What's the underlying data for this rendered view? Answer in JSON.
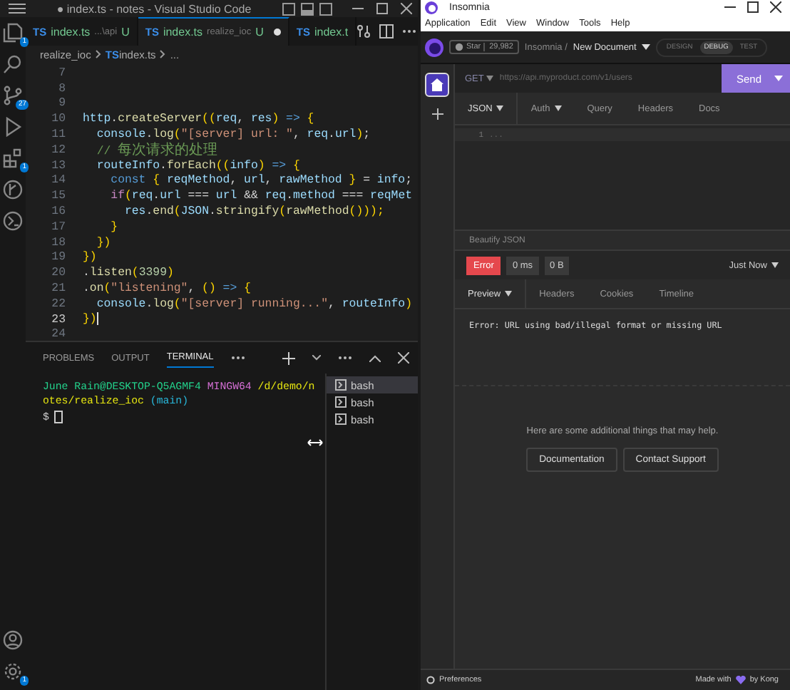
{
  "vscode": {
    "title": "● index.ts - notes - Visual Studio Code",
    "activity_bar": [
      {
        "kind": "files",
        "badge": "1"
      },
      {
        "kind": "search"
      },
      {
        "kind": "branch",
        "badge": "27"
      },
      {
        "kind": "run"
      },
      {
        "kind": "extensions",
        "badge": "1"
      },
      {
        "kind": "graph"
      },
      {
        "kind": "remote"
      }
    ],
    "settings_badge": "1",
    "tabs": [
      {
        "icon": "TS",
        "name": "index.ts",
        "detail": "...\\api",
        "status": "U",
        "selected": false,
        "dirty": false
      },
      {
        "icon": "TS",
        "name": "index.ts",
        "detail": "realize_ioc",
        "status": "U",
        "selected": true,
        "dirty": true
      },
      {
        "icon": "TS",
        "name": "index.t",
        "selected": false,
        "dirty": false
      }
    ],
    "breadcrumb": [
      {
        "text": "realize_ioc"
      },
      {
        "icon": "TS",
        "text": "index.ts"
      },
      {
        "text": "..."
      }
    ],
    "code_lines": [
      {
        "number": "7",
        "current": false
      },
      {
        "number": "8",
        "current": false
      },
      {
        "number": "9",
        "current": false
      },
      {
        "number": "10",
        "current": false,
        "tokens": [
          {
            "text": "http",
            "kind": "var"
          },
          {
            "text": ".",
            "kind": "punc"
          },
          {
            "text": "createServer",
            "kind": "fn"
          },
          {
            "text": "((",
            "kind": "bracket"
          },
          {
            "text": "req",
            "kind": "var"
          },
          {
            "text": ", ",
            "kind": "punc"
          },
          {
            "text": "res",
            "kind": "var"
          },
          {
            "text": ")",
            "kind": "bracket"
          },
          {
            "text": " => ",
            "kind": "kw"
          },
          {
            "text": "{",
            "kind": "bracket"
          }
        ]
      },
      {
        "number": "11",
        "current": false,
        "tokens": [
          {
            "text": "  console",
            "kind": "var"
          },
          {
            "text": ".",
            "kind": "punc"
          },
          {
            "text": "log",
            "kind": "fn"
          },
          {
            "text": "(",
            "kind": "bracket"
          },
          {
            "text": "\"[server] url: \"",
            "kind": "str"
          },
          {
            "text": ", ",
            "kind": "punc"
          },
          {
            "text": "req",
            "kind": "var"
          },
          {
            "text": ".",
            "kind": "punc"
          },
          {
            "text": "url",
            "kind": "var"
          },
          {
            "text": ")",
            "kind": "bracket"
          },
          {
            "text": ";",
            "kind": "punc"
          }
        ]
      },
      {
        "number": "12",
        "current": false,
        "tokens": [
          {
            "text": "  // ",
            "kind": "comment"
          },
          {
            "text": "每次请求的处理",
            "kind": "comment"
          }
        ]
      },
      {
        "number": "13",
        "current": false,
        "tokens": [
          {
            "text": "  routeInfo",
            "kind": "var"
          },
          {
            "text": ".",
            "kind": "punc"
          },
          {
            "text": "forEach",
            "kind": "fn"
          },
          {
            "text": "((",
            "kind": "bracket"
          },
          {
            "text": "info",
            "kind": "var"
          },
          {
            "text": ")",
            "kind": "bracket"
          },
          {
            "text": " => ",
            "kind": "kw"
          },
          {
            "text": "{",
            "kind": "bracket"
          }
        ]
      },
      {
        "number": "14",
        "current": false,
        "tokens": [
          {
            "text": "    const ",
            "kind": "kw"
          },
          {
            "text": "{ ",
            "kind": "bracket"
          },
          {
            "text": "reqMethod",
            "kind": "var"
          },
          {
            "text": ", ",
            "kind": "punc"
          },
          {
            "text": "url",
            "kind": "var"
          },
          {
            "text": ", ",
            "kind": "punc"
          },
          {
            "text": "rawMethod",
            "kind": "var"
          },
          {
            "text": " }",
            "kind": "bracket"
          },
          {
            "text": " = ",
            "kind": "punc"
          },
          {
            "text": "info",
            "kind": "var"
          },
          {
            "text": ";",
            "kind": "punc"
          }
        ]
      },
      {
        "number": "15",
        "current": false,
        "tokens": [
          {
            "text": "    if",
            "kind": "ctrl"
          },
          {
            "text": "(",
            "kind": "bracket"
          },
          {
            "text": "req",
            "kind": "var"
          },
          {
            "text": ".",
            "kind": "punc"
          },
          {
            "text": "url",
            "kind": "var"
          },
          {
            "text": " === ",
            "kind": "punc"
          },
          {
            "text": "url",
            "kind": "var"
          },
          {
            "text": " && ",
            "kind": "punc"
          },
          {
            "text": "req",
            "kind": "var"
          },
          {
            "text": ".",
            "kind": "punc"
          },
          {
            "text": "method",
            "kind": "var"
          },
          {
            "text": " === ",
            "kind": "punc"
          },
          {
            "text": "reqMet",
            "kind": "var"
          }
        ]
      },
      {
        "number": "16",
        "current": false,
        "tokens": [
          {
            "text": "      res",
            "kind": "var"
          },
          {
            "text": ".",
            "kind": "punc"
          },
          {
            "text": "end",
            "kind": "fn"
          },
          {
            "text": "(",
            "kind": "bracket"
          },
          {
            "text": "JSON",
            "kind": "var"
          },
          {
            "text": ".",
            "kind": "punc"
          },
          {
            "text": "stringify",
            "kind": "fn"
          },
          {
            "text": "(",
            "kind": "bracket"
          },
          {
            "text": "rawMethod",
            "kind": "fn"
          },
          {
            "text": "()));",
            "kind": "bracket"
          }
        ]
      },
      {
        "number": "17",
        "current": false,
        "tokens": [
          {
            "text": "    }",
            "kind": "bracket"
          }
        ]
      },
      {
        "number": "18",
        "current": false,
        "tokens": [
          {
            "text": "  })",
            "kind": "bracket"
          }
        ]
      },
      {
        "number": "19",
        "current": false,
        "tokens": [
          {
            "text": "})",
            "kind": "bracket"
          }
        ]
      },
      {
        "number": "20",
        "current": false,
        "tokens": [
          {
            "text": ".",
            "kind": "punc"
          },
          {
            "text": "listen",
            "kind": "fn"
          },
          {
            "text": "(",
            "kind": "bracket"
          },
          {
            "text": "3399",
            "kind": "num"
          },
          {
            "text": ")",
            "kind": "bracket"
          }
        ]
      },
      {
        "number": "21",
        "current": false,
        "tokens": [
          {
            "text": ".",
            "kind": "punc"
          },
          {
            "text": "on",
            "kind": "fn"
          },
          {
            "text": "(",
            "kind": "bracket"
          },
          {
            "text": "\"listening\"",
            "kind": "str"
          },
          {
            "text": ", ",
            "kind": "punc"
          },
          {
            "text": "()",
            "kind": "bracket"
          },
          {
            "text": " => ",
            "kind": "kw"
          },
          {
            "text": "{",
            "kind": "bracket"
          }
        ]
      },
      {
        "number": "22",
        "current": false,
        "tokens": [
          {
            "text": "  console",
            "kind": "var"
          },
          {
            "text": ".",
            "kind": "punc"
          },
          {
            "text": "log",
            "kind": "fn"
          },
          {
            "text": "(",
            "kind": "bracket"
          },
          {
            "text": "\"[server] running...\"",
            "kind": "str"
          },
          {
            "text": ", ",
            "kind": "punc"
          },
          {
            "text": "routeInfo",
            "kind": "var"
          },
          {
            "text": ")",
            "kind": "bracket"
          }
        ]
      },
      {
        "number": "23",
        "current": true,
        "tokens": [
          {
            "text": "})",
            "kind": "bracket"
          }
        ]
      },
      {
        "number": "24",
        "current": false
      }
    ],
    "panel_tabs": [
      {
        "label": "PROBLEMS",
        "selected": false
      },
      {
        "label": "OUTPUT",
        "selected": false
      },
      {
        "label": "TERMINAL",
        "selected": true
      }
    ],
    "terminal_lines": [
      [
        {
          "text": "June Rain@DESKTOP-Q5AGMF4",
          "kind": "user"
        },
        {
          "text": " MINGW64",
          "kind": "host"
        },
        {
          "text": " /d/demo/n",
          "kind": "path"
        }
      ],
      [
        {
          "text": "otes/realize_ioc",
          "kind": "path"
        },
        {
          "text": " (main)",
          "kind": "branch"
        }
      ],
      [
        {
          "text": "$",
          "kind": "prompt"
        }
      ]
    ],
    "terminals": [
      {
        "label": "bash",
        "selected": true
      },
      {
        "label": "bash",
        "selected": false
      },
      {
        "label": "bash",
        "selected": false
      }
    ]
  },
  "insomnia": {
    "title": "Insomnia",
    "menu": [
      "Application",
      "Edit",
      "View",
      "Window",
      "Tools",
      "Help"
    ],
    "star_label": "Star",
    "star_count": "29,982",
    "project": "Insomnia /",
    "document": "New Document",
    "modes": [
      {
        "label": "DESIGN",
        "selected": false
      },
      {
        "label": "DEBUG",
        "selected": true
      },
      {
        "label": "TEST",
        "selected": false
      }
    ],
    "method": "GET",
    "url_placeholder": "https://api.myproduct.com/v1/users",
    "send": "Send",
    "request_tabs": [
      {
        "label": "JSON",
        "dropdown": true,
        "selected": true
      },
      {
        "label": "Auth",
        "dropdown": true,
        "selected": false
      },
      {
        "label": "Query",
        "dropdown": false,
        "selected": false
      },
      {
        "label": "Headers",
        "dropdown": false,
        "selected": false
      },
      {
        "label": "Docs",
        "dropdown": false,
        "selected": false
      }
    ],
    "editor_lines": [
      {
        "number": "1",
        "text": "..."
      }
    ],
    "beautify": "Beautify JSON",
    "status": {
      "label": "Error",
      "kind": "error",
      "time": "0 ms",
      "size": "0 B",
      "when": "Just Now"
    },
    "response_tabs": [
      {
        "label": "Preview",
        "dropdown": true,
        "selected": true
      },
      {
        "label": "Headers",
        "dropdown": false,
        "selected": false
      },
      {
        "label": "Cookies",
        "dropdown": false,
        "selected": false
      },
      {
        "label": "Timeline",
        "dropdown": false,
        "selected": false
      }
    ],
    "error_text": "Error: URL using bad/illegal format or missing URL",
    "help_text": "Here are some additional things that may help.",
    "help_buttons": [
      "Documentation",
      "Contact Support"
    ],
    "preferences": "Preferences",
    "made_with": "Made with",
    "by_kong": "by Kong"
  }
}
